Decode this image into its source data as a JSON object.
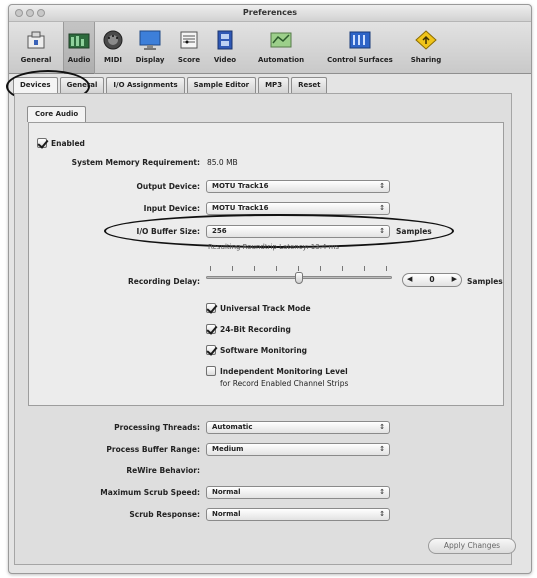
{
  "window": {
    "title": "Preferences"
  },
  "toolbar": {
    "items": [
      {
        "label": "General",
        "icon": "general-icon"
      },
      {
        "label": "Audio",
        "icon": "audio-icon"
      },
      {
        "label": "MIDI",
        "icon": "midi-icon"
      },
      {
        "label": "Display",
        "icon": "display-icon"
      },
      {
        "label": "Score",
        "icon": "score-icon"
      },
      {
        "label": "Video",
        "icon": "video-icon"
      },
      {
        "label": "Automation",
        "icon": "automation-icon"
      },
      {
        "label": "Control Surfaces",
        "icon": "control-surfaces-icon"
      },
      {
        "label": "Sharing",
        "icon": "sharing-icon"
      }
    ],
    "selected": "Audio"
  },
  "tabs": [
    "Devices",
    "General",
    "I/O Assignments",
    "Sample Editor",
    "MP3",
    "Reset"
  ],
  "active_tab": "Devices",
  "subtab": "Core Audio",
  "core_audio": {
    "enabled_label": "Enabled",
    "enabled": true,
    "memory_label": "System Memory Requirement:",
    "memory_value": "85.0 MB",
    "output_device_label": "Output Device:",
    "output_device": "MOTU Track16",
    "input_device_label": "Input Device:",
    "input_device": "MOTU Track16",
    "buffer_size_label": "I/O Buffer Size:",
    "buffer_size": "256",
    "buffer_unit": "Samples",
    "latency_text": "Resulting Roundtrip Latency: 13.4 ms",
    "recording_delay_label": "Recording Delay:",
    "recording_delay_value": "0",
    "recording_delay_unit": "Samples",
    "recording_delay_slider_fraction": 0.5,
    "options": [
      {
        "label": "Universal Track Mode",
        "checked": true
      },
      {
        "label": "24-Bit Recording",
        "checked": true
      },
      {
        "label": "Software Monitoring",
        "checked": true
      },
      {
        "label": "Independent Monitoring Level",
        "checked": false
      }
    ],
    "independent_sublabel": "for Record Enabled Channel Strips"
  },
  "bottom": {
    "processing_threads_label": "Processing Threads:",
    "processing_threads": "Automatic",
    "buffer_range_label": "Process Buffer Range:",
    "buffer_range": "Medium",
    "rewire_label": "ReWire Behavior:",
    "scrub_speed_label": "Maximum Scrub Speed:",
    "scrub_speed": "Normal",
    "scrub_response_label": "Scrub Response:",
    "scrub_response": "Normal"
  },
  "apply_button": "Apply Changes"
}
